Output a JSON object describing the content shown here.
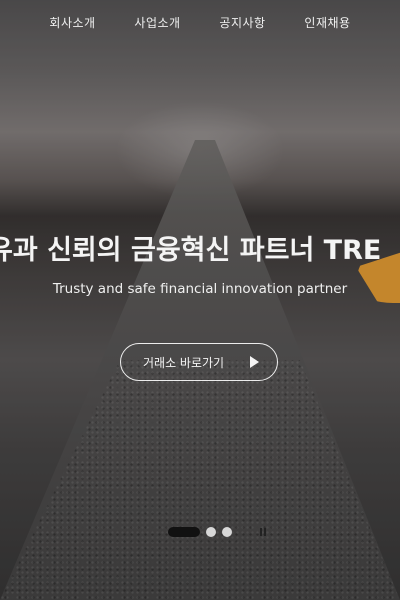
{
  "nav": {
    "items": [
      {
        "label": "회사소개"
      },
      {
        "label": "사업소개"
      },
      {
        "label": "공지사항"
      },
      {
        "label": "인재채용"
      }
    ]
  },
  "hero": {
    "headline": "유과 신뢰의 금융혁신 파트너 TRE",
    "subline": "Trusty and safe financial innovation partner",
    "cta_label": "거래소 바로가기",
    "accent_color": "#c4862c"
  },
  "pager": {
    "slide_count": 3,
    "active_index": 0,
    "pause_icon": "pause-icon"
  }
}
